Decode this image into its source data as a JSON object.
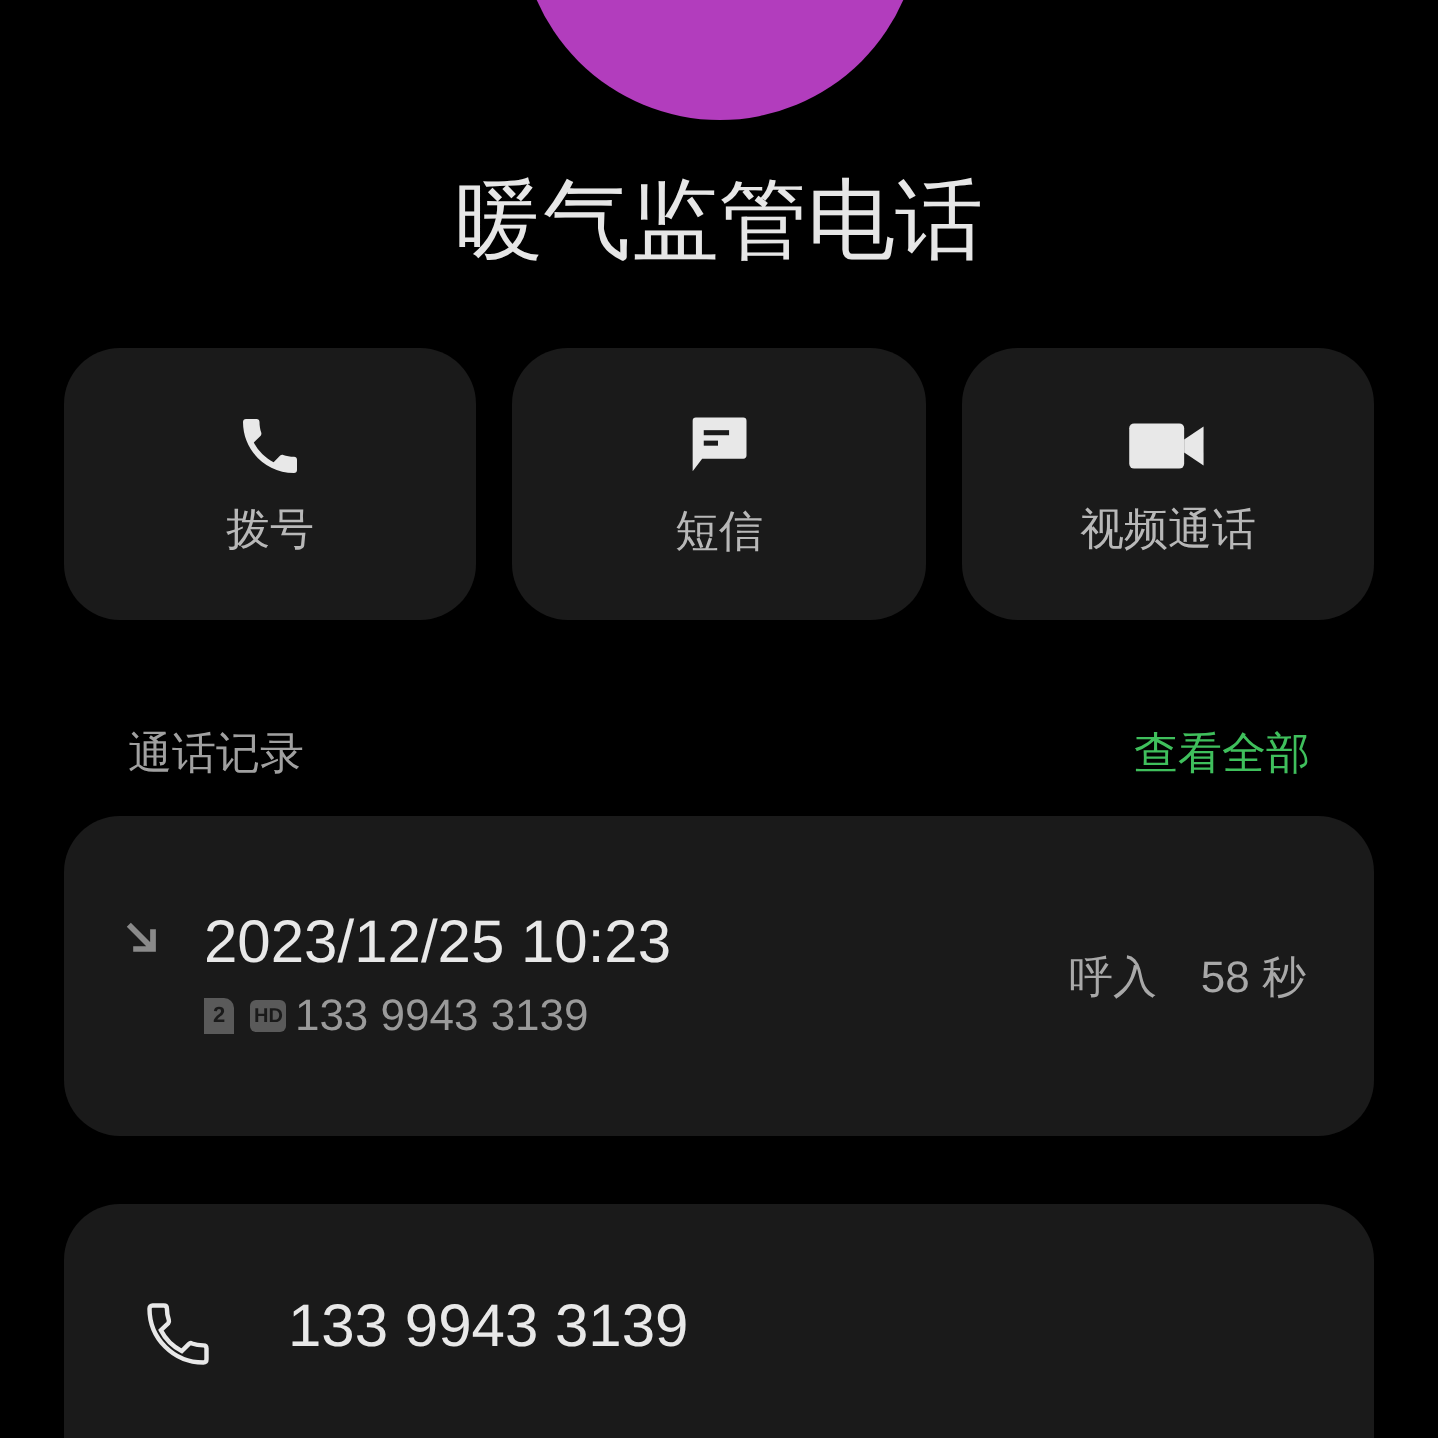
{
  "contact": {
    "name": "暖气监管电话"
  },
  "actions": [
    {
      "kind": "call",
      "label": "拨号"
    },
    {
      "kind": "message",
      "label": "短信"
    },
    {
      "kind": "video",
      "label": "视频通话"
    }
  ],
  "call_log": {
    "title": "通话记录",
    "link": "查看全部",
    "entries": [
      {
        "kind": "incoming",
        "time": "2023/12/25 10:23",
        "sim": "2",
        "hd": "HD",
        "number": "133 9943 3139",
        "type": "呼入",
        "duration": "58 秒"
      }
    ]
  },
  "numbers": [
    {
      "number": "133 9943 3139"
    }
  ]
}
